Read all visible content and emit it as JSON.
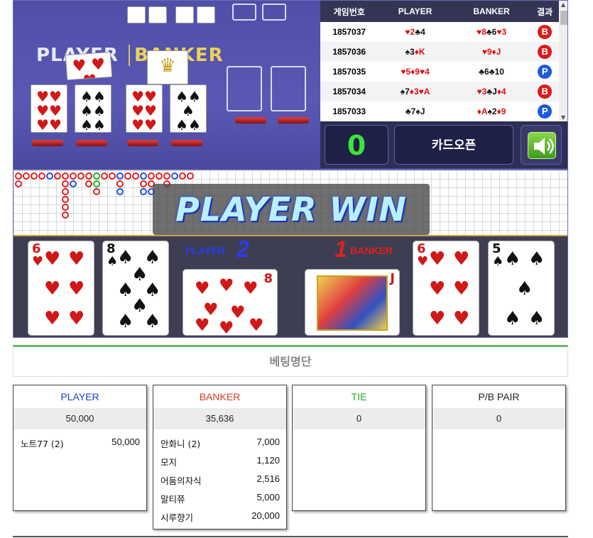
{
  "table_area": {
    "player_label": "PLAYER",
    "banker_label": "BANKER"
  },
  "results": {
    "headers": [
      "게임번호",
      "PLAYER",
      "BANKER",
      "결과"
    ],
    "rows": [
      {
        "id": "1857037",
        "player": [
          [
            "♥2",
            "r"
          ],
          [
            "♣4",
            "b"
          ]
        ],
        "banker": [
          [
            "♥8",
            "r"
          ],
          [
            "♣6",
            "b"
          ],
          [
            "♥3",
            "r"
          ]
        ],
        "result": "B"
      },
      {
        "id": "1857036",
        "player": [
          [
            "♠3",
            "b"
          ],
          [
            "♦K",
            "r"
          ]
        ],
        "banker": [
          [
            "♥9",
            "r"
          ],
          [
            "♦J",
            "r"
          ]
        ],
        "result": "B"
      },
      {
        "id": "1857035",
        "player": [
          [
            "♥5",
            "r"
          ],
          [
            "♦9",
            "r"
          ],
          [
            "♥4",
            "r"
          ]
        ],
        "banker": [
          [
            "♣6",
            "b"
          ],
          [
            "♣10",
            "b"
          ]
        ],
        "result": "P"
      },
      {
        "id": "1857034",
        "player": [
          [
            "♠7",
            "b"
          ],
          [
            "♦3",
            "r"
          ],
          [
            "♥A",
            "r"
          ]
        ],
        "banker": [
          [
            "♥3",
            "r"
          ],
          [
            "♣J",
            "b"
          ],
          [
            "♦4",
            "r"
          ]
        ],
        "result": "B"
      },
      {
        "id": "1857033",
        "player": [
          [
            "♣7",
            "b"
          ],
          [
            "♠J",
            "b"
          ]
        ],
        "banker": [
          [
            "♦A",
            "r"
          ],
          [
            "♠2",
            "b"
          ],
          [
            "♦9",
            "r"
          ]
        ],
        "result": "P"
      }
    ]
  },
  "controls": {
    "count": "0",
    "open_cards": "카드오픈"
  },
  "banner": {
    "text": "PLAYER WIN"
  },
  "cards": {
    "player_label": "PLAYER",
    "player_score": "2",
    "banker_label": "BANKER",
    "banker_score": "1"
  },
  "betting": {
    "title": "베팅명단",
    "panels": [
      {
        "title": "PLAYER",
        "color": "#1e3fd0",
        "total": "50,000",
        "rows": [
          {
            "name": "노트77 (2)",
            "amount": "50,000"
          }
        ]
      },
      {
        "title": "BANKER",
        "color": "#d83a2a",
        "total": "35,636",
        "rows": [
          {
            "name": "안화니 (2)",
            "amount": "7,000"
          },
          {
            "name": "모지",
            "amount": "1,120"
          },
          {
            "name": "어둠의자식",
            "amount": "2,516"
          },
          {
            "name": "말티쮸",
            "amount": "5,000"
          },
          {
            "name": "시루향기",
            "amount": "20,000"
          }
        ]
      },
      {
        "title": "TIE",
        "color": "#25a825",
        "total": "0",
        "rows": []
      },
      {
        "title": "P/B PAIR",
        "color": "#222222",
        "total": "0",
        "rows": []
      }
    ]
  }
}
